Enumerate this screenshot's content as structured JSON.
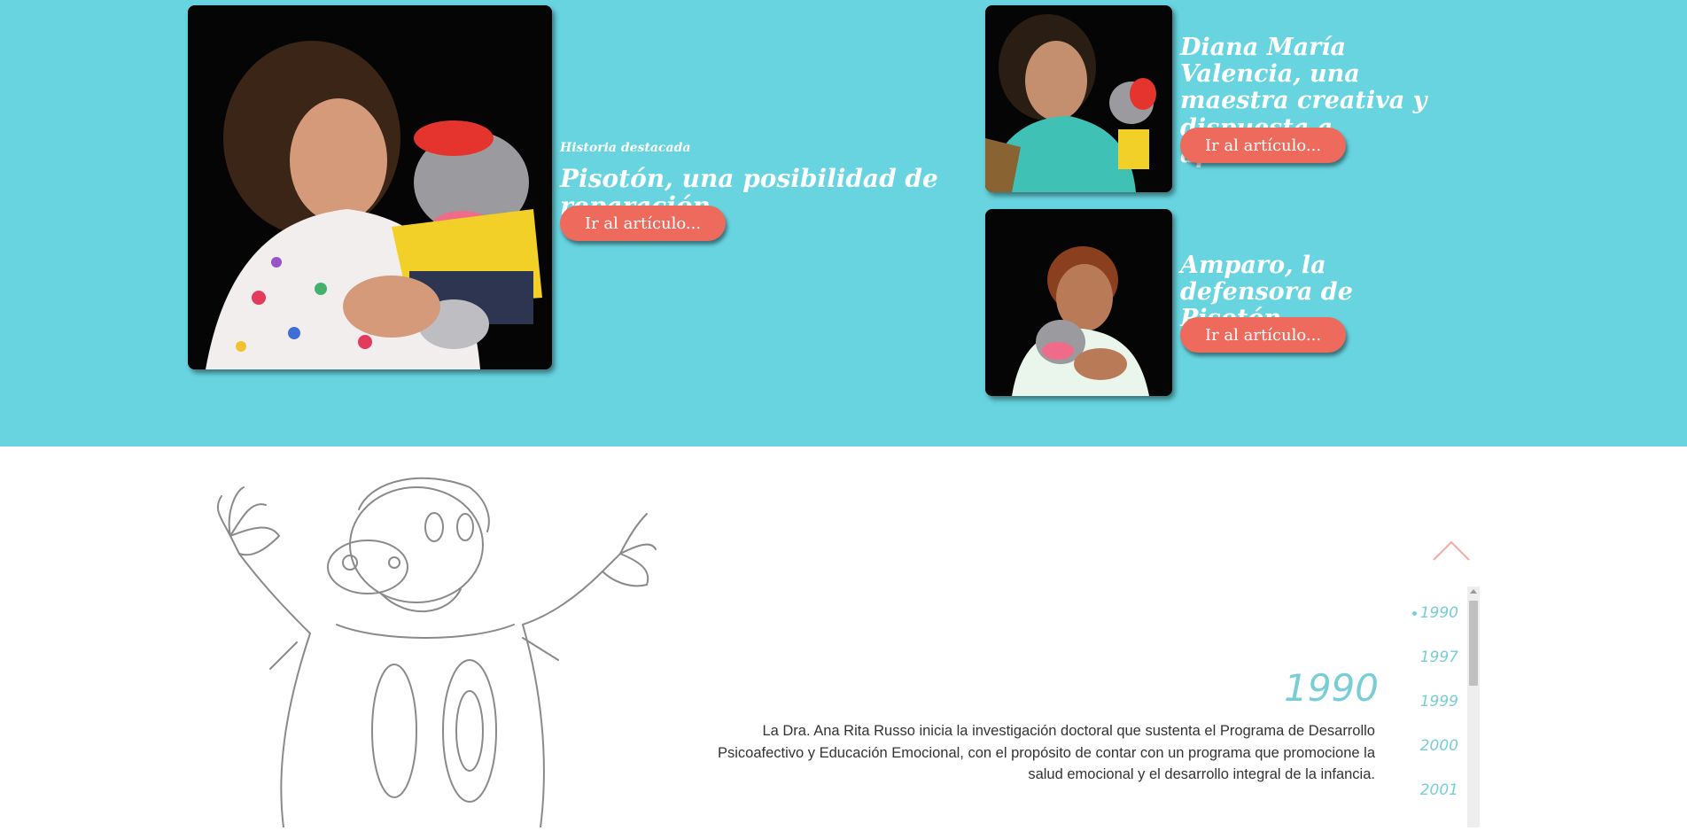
{
  "featured": {
    "kicker": "Historia destacada",
    "title": "Pisotón, una posibilidad de reparación",
    "button": "Ir al artículo..."
  },
  "stories": [
    {
      "title": "Diana María Valencia, una maestra creativa y dispuesta a aprender.",
      "button": "Ir al artículo..."
    },
    {
      "title": "Amparo, la defensora de Pisotón.",
      "button": "Ir al artículo..."
    }
  ],
  "timeline": {
    "current_year": "1990",
    "description": "La Dra. Ana Rita Russo inicia la investigación doctoral que sustenta el Programa de Desarrollo Psicoafectivo y Educación Emocional, con el propósito de contar con un programa que promocione la salud emocional y el desarrollo integral de la infancia.",
    "years": [
      "1990",
      "1997",
      "1999",
      "2000",
      "2001"
    ]
  },
  "colors": {
    "hero_bg": "#67d4e0",
    "button": "#ee6a5c",
    "accent": "#78cdd6"
  }
}
